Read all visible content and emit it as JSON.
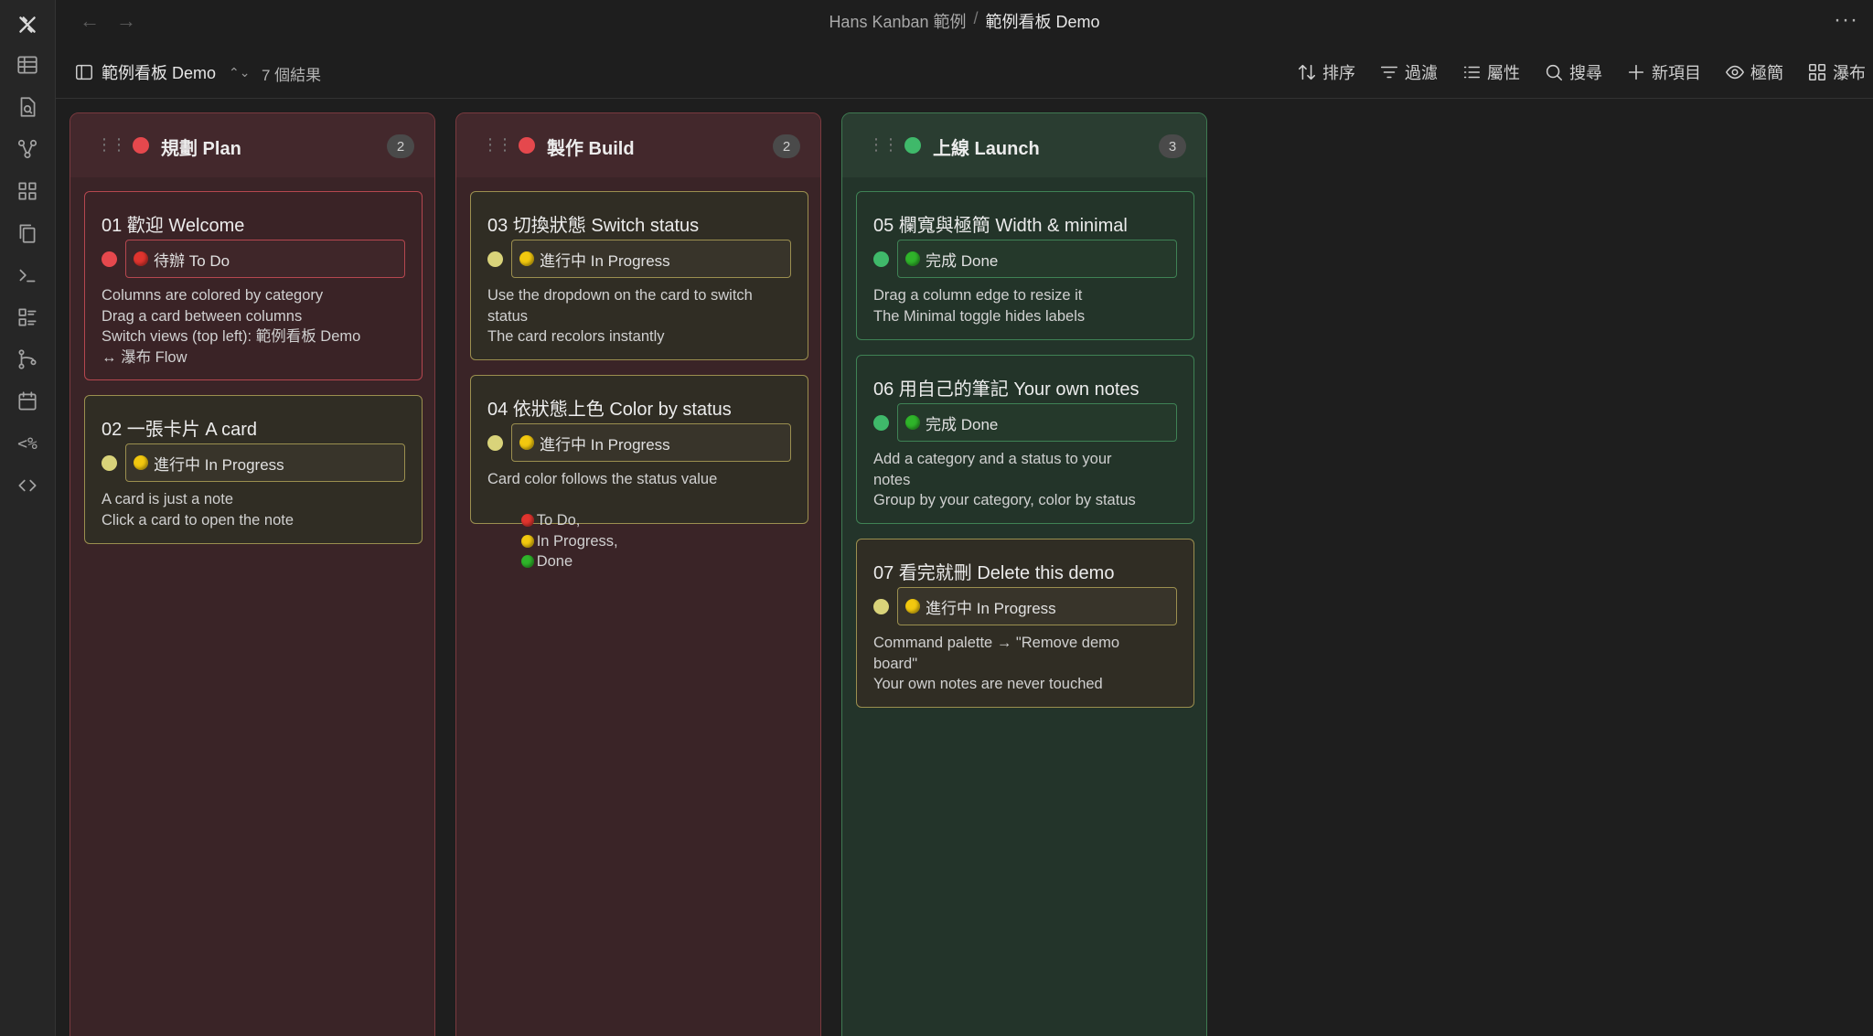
{
  "colors": {
    "red": "#e5484d",
    "yellow": "#d9d37a",
    "green": "#3fb96a",
    "emoji_red": "#e0342e",
    "emoji_yellow": "#f2c80f",
    "emoji_green": "#2fb42a"
  },
  "titlebar": {
    "vault": "Hans Kanban 範例",
    "separator": "/",
    "current": "範例看板 Demo",
    "more": "···"
  },
  "toolbar": {
    "view_name": "範例看板 Demo",
    "result_count": "7 個結果",
    "tools": [
      {
        "icon": "sort-icon",
        "label": "排序"
      },
      {
        "icon": "filter-icon",
        "label": "過濾"
      },
      {
        "icon": "properties-icon",
        "label": "屬性"
      },
      {
        "icon": "search-icon",
        "label": "搜尋"
      },
      {
        "icon": "plus-icon",
        "label": "新項目"
      },
      {
        "icon": "eye-icon",
        "label": "極簡"
      },
      {
        "icon": "grid-icon",
        "label": "瀑布"
      }
    ]
  },
  "columns": [
    {
      "title": "規劃 Plan",
      "count": "2",
      "color": "red",
      "cards": [
        {
          "title": "01 歡迎 Welcome",
          "status": "待辦 To Do",
          "status_color": "red",
          "lines": [
            "Columns are colored by category",
            "Drag a card between columns",
            "Switch views (top left): 範例看板 Demo",
            "↔ 瀑布 Flow"
          ]
        },
        {
          "title": "02 一張卡片 A card",
          "status": "進行中 In Progress",
          "status_color": "yellow",
          "lines": [
            "A card is just a note",
            "Click a card to open the note"
          ]
        }
      ]
    },
    {
      "title": "製作 Build",
      "count": "2",
      "color": "red",
      "cards": [
        {
          "title": "03 切換狀態 Switch status",
          "status": "進行中 In Progress",
          "status_color": "yellow",
          "lines": [
            "Use the dropdown on the card to switch",
            "status",
            "The card recolors instantly"
          ]
        },
        {
          "title": "04 依狀態上色 Color by status",
          "status": "進行中 In Progress",
          "status_color": "yellow",
          "lines": [
            "Card color follows the status value"
          ],
          "legend": {
            "todo": "To Do,",
            "progress": "In Progress,",
            "done": "Done"
          }
        }
      ]
    },
    {
      "title": "上線 Launch",
      "count": "3",
      "color": "green",
      "cards": [
        {
          "title": "05 欄寬與極簡 Width & minimal",
          "status": "完成 Done",
          "status_color": "green",
          "lines": [
            "Drag a column edge to resize it",
            "The Minimal toggle hides labels"
          ]
        },
        {
          "title": "06 用自己的筆記 Your own notes",
          "status": "完成 Done",
          "status_color": "green",
          "lines": [
            "Add a category and a status to your",
            "notes",
            "Group by your category, color by status"
          ]
        },
        {
          "title": "07 看完就刪 Delete this demo",
          "status": "進行中 In Progress",
          "status_color": "yellow",
          "lines": [
            "Command palette → \"Remove demo",
            "board\"",
            "Your own notes are never touched"
          ]
        }
      ]
    }
  ]
}
